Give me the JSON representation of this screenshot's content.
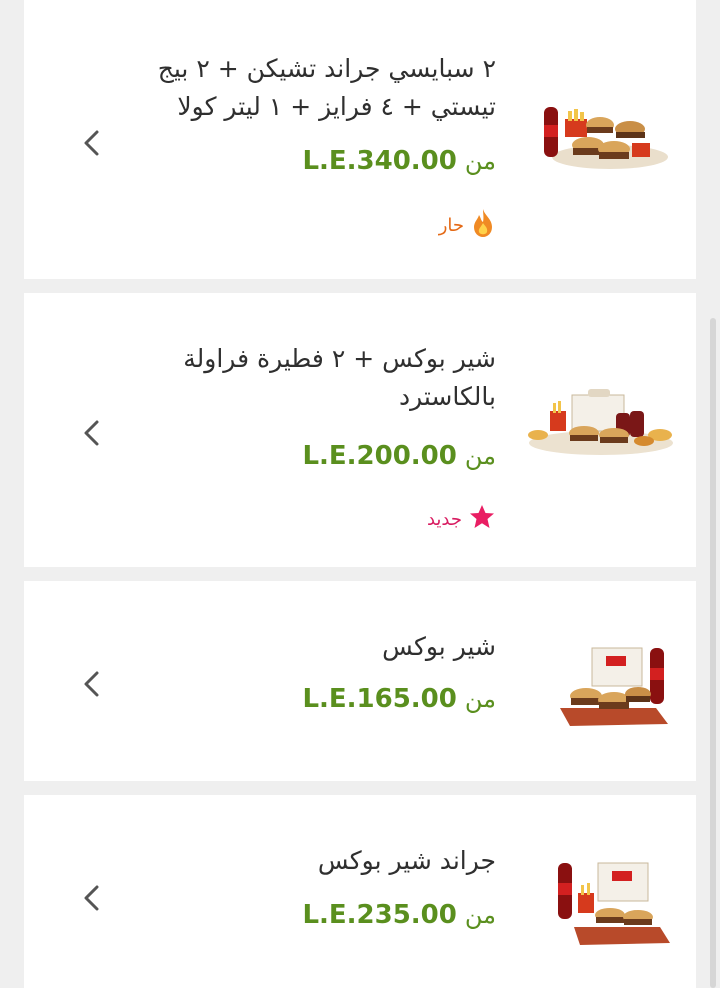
{
  "colors": {
    "background": "#efefef",
    "price": "#5a8f1e",
    "hot_badge": "#e46a17",
    "new_badge": "#d81b60"
  },
  "items": [
    {
      "title": "٢ سبايسي جراند تشيكن + ٢ بيج تيستي + ٤ فرايز + ١ ليتر كولا",
      "price_prefix": "من",
      "price": "L.E.340.00",
      "badge": "حار",
      "badge_icon": "flame-icon"
    },
    {
      "title": "شير بوكس + ٢ فطيرة فراولة بالكاسترد",
      "price_prefix": "من",
      "price": "L.E.200.00",
      "badge": "جديد",
      "badge_icon": "star-icon"
    },
    {
      "title": "شير بوكس",
      "price_prefix": "من",
      "price": "L.E.165.00"
    },
    {
      "title": "جراند شير بوكس",
      "price_prefix": "من",
      "price": "L.E.235.00"
    }
  ]
}
